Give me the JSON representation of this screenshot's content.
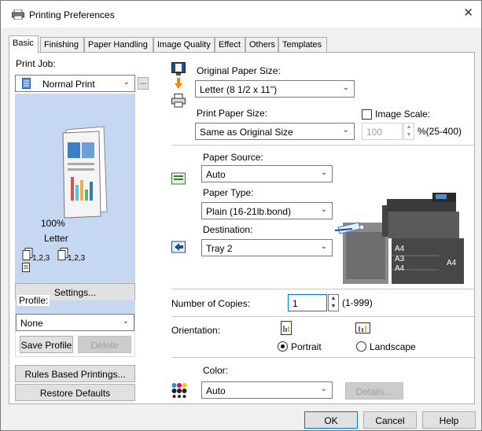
{
  "window": {
    "title": "Printing Preferences",
    "close_glyph": "✕"
  },
  "tabs": [
    {
      "label": "Basic"
    },
    {
      "label": "Finishing"
    },
    {
      "label": "Paper Handling"
    },
    {
      "label": "Image Quality"
    },
    {
      "label": "Effect"
    },
    {
      "label": "Others"
    },
    {
      "label": "Templates"
    }
  ],
  "left": {
    "print_job_label": "Print Job:",
    "print_job_value": "Normal Print",
    "print_job_more": "...",
    "preview_zoom": "100%",
    "preview_paper": "Letter",
    "preview_nup1": "1,2,3",
    "preview_nup2": "1,2,3",
    "settings_button": "Settings...",
    "profile_label": "Profile:",
    "profile_value": "None",
    "save_profile_button": "Save Profile",
    "delete_button": "Delete",
    "rules_button": "Rules Based Printings...",
    "restore_button": "Restore Defaults"
  },
  "right": {
    "original_size_label": "Original Paper Size:",
    "original_size_value": "Letter (8 1/2 x 11\")",
    "print_size_label": "Print Paper Size:",
    "print_size_value": "Same as Original Size",
    "image_scale_label": "Image Scale:",
    "image_scale_value": "100",
    "image_scale_range": "%(25-400)",
    "paper_source_label": "Paper Source:",
    "paper_source_value": "Auto",
    "paper_type_label": "Paper Type:",
    "paper_type_value": "Plain (16-21lb.bond)",
    "destination_label": "Destination:",
    "destination_value": "Tray 2",
    "printer_tray_labels": [
      "A4",
      "A3",
      "A4",
      "A4"
    ],
    "copies_label": "Number of Copies:",
    "copies_value": "1",
    "copies_range": "(1-999)",
    "orientation_label": "Orientation:",
    "portrait_label": "Portrait",
    "landscape_label": "Landscape",
    "color_label": "Color:",
    "color_value": "Auto",
    "details_button": "Details..."
  },
  "footer": {
    "ok": "OK",
    "cancel": "Cancel",
    "help": "Help"
  },
  "colors": {
    "preview_bg": "#c6d7f2",
    "accent": "#0078d7",
    "orange_arrow": "#f28c00"
  }
}
